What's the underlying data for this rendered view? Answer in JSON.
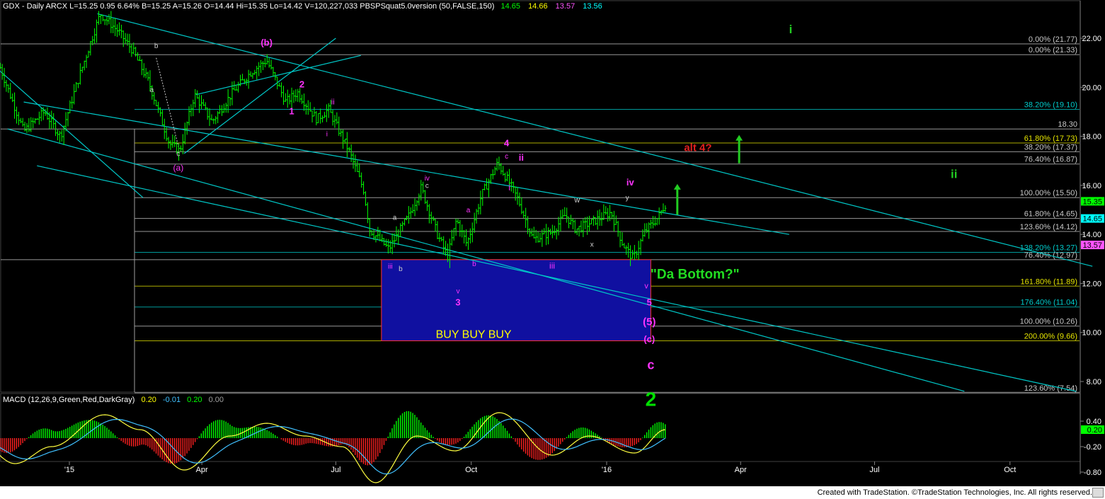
{
  "header": {
    "main": "GDX - Daily  ARCX  L=15.25  0.95  6.64%  B=15.25  A=15.26  O=14.44  Hi=15.35  Lo=14.42  V=120,227,033  PBSPSquat5.0version (50,FALSE,150)",
    "v1": "14.65",
    "v2": "14.66",
    "v3": "13.57",
    "v4": "13.56",
    "c1": "#00ff00",
    "c2": "#ffff00",
    "c3": "#ff55ff",
    "c4": "#00ffff"
  },
  "macd_header": {
    "main": "MACD (12,26,9,Green,Red,DarkGray)",
    "v1": "0.20",
    "v2": "-0.01",
    "v3": "0.20",
    "v4": "0.00"
  },
  "footer": {
    "credit": "Created with TradeStation. ©TradeStation Technologies, Inc. All rights reserved."
  },
  "colors": {
    "background": "#000000",
    "bars": "#00ff00",
    "channel": "#00c8c8",
    "fib_line": "#c8c8c8",
    "fib_green": "#00ff00",
    "fib_yellow": "#e6e600",
    "wave_label": "#ff33ff",
    "alt_label": "#ff2020",
    "box_fill": "#1010a0",
    "box_border": "#ff3030",
    "buy_text": "#ffff00",
    "macd_pos": "#00ff00",
    "macd_neg": "#ff2020",
    "macd_line": "#ffff40",
    "signal_line": "#40c0ff"
  },
  "chart_data": {
    "type": "candlestick",
    "symbol": "GDX",
    "timeframe": "Daily",
    "x_labels": [
      "'15",
      "Apr",
      "Jul",
      "Oct",
      "'16",
      "Apr",
      "Jul",
      "Oct"
    ],
    "price_axis": {
      "range": [
        7.5,
        23.2
      ],
      "ticks": [
        "22.00",
        "20.00",
        "18.00",
        "16.00",
        "14.00",
        "12.00",
        "10.00",
        "8.00"
      ]
    },
    "last_price_tags": [
      {
        "label": "15.35",
        "value": 15.35,
        "color": "#00ff00"
      },
      {
        "label": "14.65",
        "value": 14.65,
        "color": "#00ffff"
      },
      {
        "label": "13.57",
        "value": 13.57,
        "color": "#ff55ff"
      }
    ],
    "price_anchors": [
      {
        "date": "2014-11-15",
        "value": 20.8
      },
      {
        "date": "2014-12-01",
        "value": 18.2
      },
      {
        "date": "2014-12-15",
        "value": 19.0
      },
      {
        "date": "2014-12-26",
        "value": 18.0
      },
      {
        "date": "2015-01-08",
        "value": 20.5
      },
      {
        "date": "2015-01-22",
        "value": 23.0
      },
      {
        "date": "2015-02-03",
        "value": 22.3
      },
      {
        "date": "2015-02-13",
        "value": 21.5
      },
      {
        "date": "2015-02-24",
        "value": 20.2
      },
      {
        "date": "2015-03-10",
        "value": 17.7
      },
      {
        "date": "2015-03-17",
        "value": 17.4
      },
      {
        "date": "2015-03-27",
        "value": 19.7
      },
      {
        "date": "2015-04-08",
        "value": 18.6
      },
      {
        "date": "2015-04-22",
        "value": 19.8
      },
      {
        "date": "2015-05-04",
        "value": 20.6
      },
      {
        "date": "2015-05-15",
        "value": 21.1
      },
      {
        "date": "2015-05-28",
        "value": 19.4
      },
      {
        "date": "2015-06-05",
        "value": 19.8
      },
      {
        "date": "2015-06-18",
        "value": 18.7
      },
      {
        "date": "2015-06-26",
        "value": 19.1
      },
      {
        "date": "2015-07-10",
        "value": 17.4
      },
      {
        "date": "2015-07-20",
        "value": 15.8
      },
      {
        "date": "2015-07-24",
        "value": 14.2
      },
      {
        "date": "2015-08-06",
        "value": 13.4
      },
      {
        "date": "2015-08-20",
        "value": 14.8
      },
      {
        "date": "2015-08-28",
        "value": 15.9
      },
      {
        "date": "2015-09-08",
        "value": 14.0
      },
      {
        "date": "2015-09-15",
        "value": 13.1
      },
      {
        "date": "2015-09-21",
        "value": 14.6
      },
      {
        "date": "2015-09-28",
        "value": 13.6
      },
      {
        "date": "2015-10-08",
        "value": 15.6
      },
      {
        "date": "2015-10-19",
        "value": 16.9
      },
      {
        "date": "2015-10-26",
        "value": 16.2
      },
      {
        "date": "2015-11-02",
        "value": 15.4
      },
      {
        "date": "2015-11-12",
        "value": 13.8
      },
      {
        "date": "2015-11-25",
        "value": 14.1
      },
      {
        "date": "2015-12-04",
        "value": 14.8
      },
      {
        "date": "2015-12-11",
        "value": 14.2
      },
      {
        "date": "2015-12-22",
        "value": 14.5
      },
      {
        "date": "2016-01-04",
        "value": 14.9
      },
      {
        "date": "2016-01-12",
        "value": 13.6
      },
      {
        "date": "2016-01-19",
        "value": 13.0
      },
      {
        "date": "2016-01-27",
        "value": 14.1
      },
      {
        "date": "2016-02-05",
        "value": 14.7
      },
      {
        "date": "2016-02-10",
        "value": 15.25
      }
    ],
    "fib_levels": [
      {
        "label": "0.00% (21.77)",
        "value": 21.77,
        "color": "#c8c8c8"
      },
      {
        "label": "0.00% (21.33)",
        "value": 21.33,
        "color": "#c8c8c8"
      },
      {
        "label": "38.20% (19.10)",
        "value": 19.1,
        "color": "#00cccc"
      },
      {
        "label": "18.30",
        "value": 18.3,
        "color": "#c8c8c8"
      },
      {
        "label": "61.80% (17.73)",
        "value": 17.73,
        "color": "#e6e600"
      },
      {
        "label": "38.20% (17.37)",
        "value": 17.37,
        "color": "#c8c8c8"
      },
      {
        "label": "76.40% (16.87)",
        "value": 16.87,
        "color": "#c8c8c8"
      },
      {
        "label": "100.00% (15.50)",
        "value": 15.5,
        "color": "#c8c8c8"
      },
      {
        "label": "61.80% (14.65)",
        "value": 14.65,
        "color": "#c8c8c8"
      },
      {
        "label": "123.60% (14.12)",
        "value": 14.12,
        "color": "#c8c8c8"
      },
      {
        "label": "138.20% (13.27)",
        "value": 13.27,
        "color": "#00cccc"
      },
      {
        "label": "76.40% (12.97)",
        "value": 12.97,
        "color": "#c8c8c8"
      },
      {
        "label": "161.80% (11.89)",
        "value": 11.89,
        "color": "#e6e600"
      },
      {
        "label": "176.40% (11.04)",
        "value": 11.04,
        "color": "#00cccc"
      },
      {
        "label": "100.00% (10.26)",
        "value": 10.26,
        "color": "#c8c8c8"
      },
      {
        "label": "200.00% (9.66)",
        "value": 9.66,
        "color": "#e6e600"
      },
      {
        "label": "123.60% (7.54)",
        "value": 7.54,
        "color": "#c8c8c8"
      }
    ],
    "box": {
      "date_start": "2015-08-01",
      "date_end": "2016-01-31",
      "value_top": 12.97,
      "value_bottom": 9.66,
      "label": "BUY  BUY  BUY"
    },
    "channels": [
      {
        "d1": "2015-01-20",
        "v1": 23.0,
        "d2": "2016-11-26",
        "v2": 12.7
      },
      {
        "d1": "2014-12-01",
        "v1": 19.4,
        "d2": "2016-05-04",
        "v2": 14.0
      },
      {
        "d1": "2015-03-20",
        "v1": 17.3,
        "d2": "2015-07-01",
        "v2": 22.0
      },
      {
        "d1": "2015-03-28",
        "v1": 19.7,
        "d2": "2015-07-18",
        "v2": 21.3
      },
      {
        "d1": "2014-11-01",
        "v1": 21.4,
        "d2": "2015-02-20",
        "v2": 15.5
      },
      {
        "d1": "2014-11-20",
        "v1": 18.3,
        "d2": "2016-08-31",
        "v2": 7.6
      },
      {
        "d1": "2014-12-10",
        "v1": 16.8,
        "d2": "2016-11-15",
        "v2": 7.6
      }
    ],
    "labels": [
      {
        "text": "(a)",
        "date": "2015-03-16",
        "value": 16.6,
        "color": "#ff33ff",
        "size": 12
      },
      {
        "text": "a",
        "date": "2015-02-26",
        "value": 19.8,
        "color": "#cccccc",
        "size": 10
      },
      {
        "text": "b",
        "date": "2015-03-01",
        "value": 21.6,
        "color": "#cccccc",
        "size": 10
      },
      {
        "text": "c",
        "date": "2015-03-16",
        "value": 17.2,
        "color": "#cccccc",
        "size": 10
      },
      {
        "text": "(b)",
        "date": "2015-05-15",
        "value": 21.7,
        "color": "#ff33ff",
        "size": 13
      },
      {
        "text": "1",
        "date": "2015-06-01",
        "value": 18.9,
        "color": "#ff33ff",
        "size": 13
      },
      {
        "text": "2",
        "date": "2015-06-08",
        "value": 20.0,
        "color": "#ff33ff",
        "size": 13
      },
      {
        "text": "i",
        "date": "2015-06-25",
        "value": 18.0,
        "color": "#ff33ff",
        "size": 10
      },
      {
        "text": "ii",
        "date": "2015-06-29",
        "value": 19.3,
        "color": "#ff33ff",
        "size": 11
      },
      {
        "text": "a",
        "date": "2015-08-10",
        "value": 14.6,
        "color": "#cccccc",
        "size": 10
      },
      {
        "text": "b",
        "date": "2015-08-14",
        "value": 12.5,
        "color": "#cccccc",
        "size": 10
      },
      {
        "text": "iii",
        "date": "2015-08-07",
        "value": 12.6,
        "color": "#ff33ff",
        "size": 10
      },
      {
        "text": "iv",
        "date": "2015-09-01",
        "value": 16.2,
        "color": "#ff33ff",
        "size": 10
      },
      {
        "text": "c",
        "date": "2015-09-01",
        "value": 15.9,
        "color": "#cccccc",
        "size": 10
      },
      {
        "text": "a",
        "date": "2015-09-29",
        "value": 14.9,
        "color": "#ff33ff",
        "size": 10
      },
      {
        "text": "b",
        "date": "2015-10-03",
        "value": 12.7,
        "color": "#ff33ff",
        "size": 10
      },
      {
        "text": "v",
        "date": "2015-09-22",
        "value": 11.6,
        "color": "#ff33ff",
        "size": 10
      },
      {
        "text": "3",
        "date": "2015-09-22",
        "value": 11.1,
        "color": "#ff33ff",
        "size": 13
      },
      {
        "text": "4",
        "date": "2015-10-25",
        "value": 17.6,
        "color": "#ff33ff",
        "size": 13
      },
      {
        "text": "c",
        "date": "2015-10-25",
        "value": 17.1,
        "color": "#ff33ff",
        "size": 10
      },
      {
        "text": "ii",
        "date": "2015-11-04",
        "value": 17.0,
        "color": "#ff33ff",
        "size": 13
      },
      {
        "text": "i",
        "date": "2015-10-27",
        "value": 15.8,
        "color": "#ff33ff",
        "size": 12
      },
      {
        "text": "iii",
        "date": "2015-11-25",
        "value": 12.6,
        "color": "#ff33ff",
        "size": 12
      },
      {
        "text": "w",
        "date": "2015-12-12",
        "value": 15.3,
        "color": "#cccccc",
        "size": 11
      },
      {
        "text": "x",
        "date": "2015-12-22",
        "value": 13.5,
        "color": "#cccccc",
        "size": 10
      },
      {
        "text": "iv",
        "date": "2016-01-17",
        "value": 16.0,
        "color": "#ff33ff",
        "size": 13
      },
      {
        "text": "y",
        "date": "2016-01-15",
        "value": 15.4,
        "color": "#cccccc",
        "size": 10
      },
      {
        "text": "v",
        "date": "2016-01-28",
        "value": 11.8,
        "color": "#ff33ff",
        "size": 11
      },
      {
        "text": "5",
        "date": "2016-01-30",
        "value": 11.1,
        "color": "#ff33ff",
        "size": 13
      },
      {
        "text": "(5)",
        "date": "2016-01-30",
        "value": 10.3,
        "color": "#ff33ff",
        "size": 15
      },
      {
        "text": "(c)",
        "date": "2016-01-30",
        "value": 9.6,
        "color": "#ff33ff",
        "size": 13
      },
      {
        "text": "c",
        "date": "2016-01-31",
        "value": 8.5,
        "color": "#ff33ff",
        "size": 18
      },
      {
        "text": "2",
        "date": "2016-01-31",
        "value": 7.0,
        "color": "#00e000",
        "size": 28
      },
      {
        "text": "\"Da Bottom?\"",
        "date": "2016-03-01",
        "value": 12.2,
        "color": "#22dd22",
        "size": 19
      },
      {
        "text": "alt 4?",
        "date": "2016-03-03",
        "value": 17.4,
        "color": "#e02020",
        "size": 15
      },
      {
        "text": "i",
        "date": "2016-05-05",
        "value": 22.2,
        "color": "#22cc22",
        "size": 17
      },
      {
        "text": "ii",
        "date": "2016-08-24",
        "value": 16.3,
        "color": "#22cc22",
        "size": 17
      }
    ],
    "arrows": [
      {
        "date": "2016-02-18",
        "value_from": 14.8,
        "value_to": 16.0,
        "color": "#22cc22"
      },
      {
        "date": "2016-03-31",
        "value_from": 16.9,
        "value_to": 18.0,
        "color": "#22cc22"
      }
    ],
    "macd": {
      "axis_ticks": [
        "0.40",
        "-0.20",
        "-0.80"
      ],
      "value_tag": {
        "label": "0.20",
        "value": 0.2
      },
      "range": [
        -1.2,
        0.7
      ],
      "anchors": [
        {
          "date": "2014-11-01",
          "value": -0.1
        },
        {
          "date": "2014-11-25",
          "value": -0.6
        },
        {
          "date": "2014-12-20",
          "value": -0.2
        },
        {
          "date": "2015-01-25",
          "value": 0.55
        },
        {
          "date": "2015-02-18",
          "value": 0.2
        },
        {
          "date": "2015-03-20",
          "value": -0.75
        },
        {
          "date": "2015-04-20",
          "value": 0.05
        },
        {
          "date": "2015-05-15",
          "value": 0.35
        },
        {
          "date": "2015-06-10",
          "value": 0.05
        },
        {
          "date": "2015-07-05",
          "value": -0.2
        },
        {
          "date": "2015-07-28",
          "value": -1.05
        },
        {
          "date": "2015-08-25",
          "value": 0.05
        },
        {
          "date": "2015-09-20",
          "value": -0.3
        },
        {
          "date": "2015-10-20",
          "value": 0.6
        },
        {
          "date": "2015-11-25",
          "value": -0.4
        },
        {
          "date": "2015-12-20",
          "value": 0.05
        },
        {
          "date": "2016-01-20",
          "value": -0.35
        },
        {
          "date": "2016-02-10",
          "value": 0.2
        }
      ]
    }
  }
}
